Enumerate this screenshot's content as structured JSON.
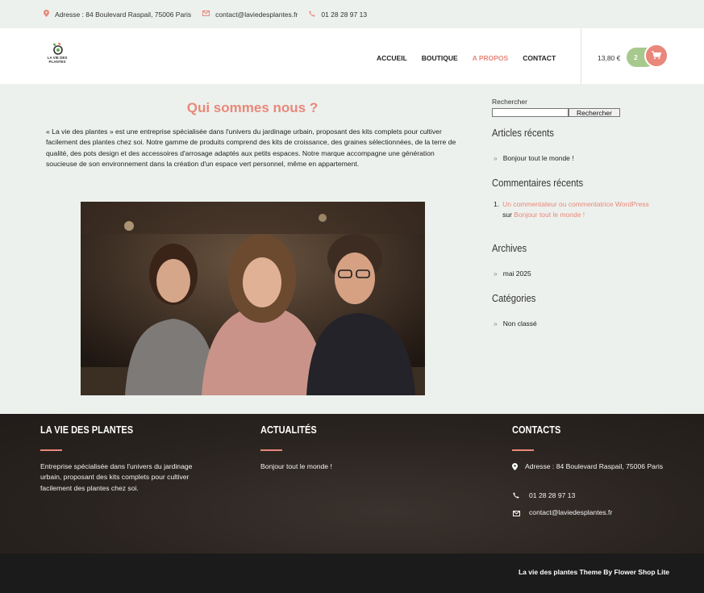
{
  "topbar": {
    "address": "Adresse : 84 Boulevard Raspail, 75006 Paris",
    "email": "contact@laviedesplantes.fr",
    "phone": "01 28 28 97 13"
  },
  "logo": {
    "line1": "LA VIE DES",
    "line2": "PLANTES"
  },
  "nav": {
    "items": [
      "ACCUEIL",
      "BOUTIQUE",
      "A PROPOS",
      "CONTACT"
    ],
    "active": "A PROPOS"
  },
  "cart": {
    "total": "13,80 €",
    "count": "2"
  },
  "main": {
    "title": "Qui sommes nous ?",
    "intro": "« La vie des plantes » est une entreprise spécialisée dans l'univers du jardinage urbain, proposant des kits complets pour cultiver facilement des plantes chez soi. Notre gamme de produits comprend des kits de croissance, des graines sélectionnées, de la terre de qualité, des pots design et des accessoires d'arrosage adaptés aux petits espaces. Notre marque accompagne une génération soucieuse de son environnement dans la création d'un espace vert personnel, même en appartement."
  },
  "sidebar": {
    "search_label": "Rechercher",
    "search_button": "Rechercher",
    "recent_posts_title": "Articles récents",
    "recent_posts": [
      "Bonjour tout le monde !"
    ],
    "recent_comments_title": "Commentaires récents",
    "comment_author": "Un commentateur ou commentatrice WordPress",
    "comment_on": "sur",
    "comment_post": "Bonjour tout le monde !",
    "archives_title": "Archives",
    "archives": [
      "mai 2025"
    ],
    "categories_title": "Catégories",
    "categories": [
      "Non classé"
    ]
  },
  "footer": {
    "col1_title": "LA VIE DES PLANTES",
    "col1_text": "Entreprise spécialisée dans l'univers du jardinage urbain, proposant des kits complets pour cultiver facilement des plantes chez soi.",
    "col2_title": "ACTUALITÉS",
    "col2_post": "Bonjour tout le monde !",
    "col3_title": "CONTACTS",
    "address": "Adresse : 84 Boulevard Raspail, 75006 Paris",
    "phone": "01 28 28 97 13",
    "email": "contact@laviedesplantes.fr",
    "credit": "La vie des plantes Theme By Flower Shop Lite"
  },
  "colors": {
    "accent": "#e9877a",
    "green": "#a8c98e",
    "background": "#edf1ed",
    "footer": "#2a2420"
  },
  "icons": [
    "map-pin-icon",
    "envelope-icon",
    "phone-icon",
    "cart-icon",
    "leaf-logo-icon"
  ]
}
